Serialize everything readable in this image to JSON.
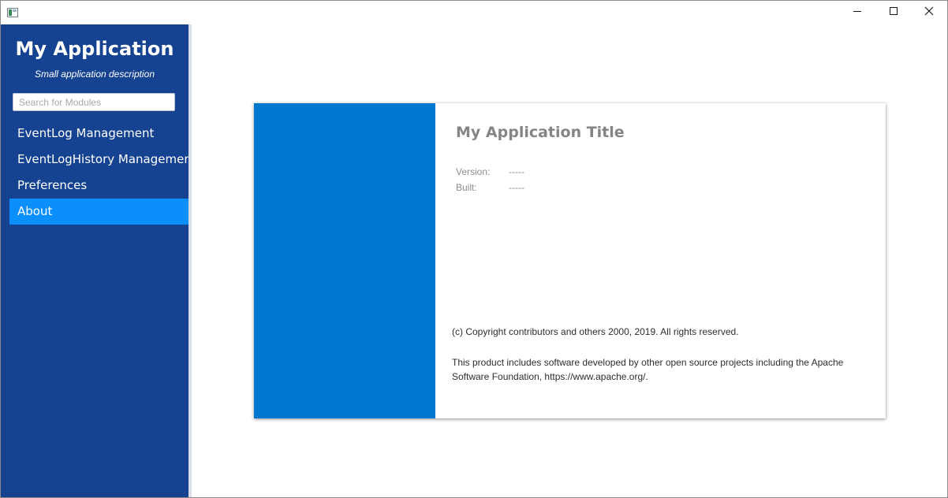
{
  "window": {
    "title": "",
    "minimize_icon": "minimize-icon",
    "maximize_icon": "maximize-icon",
    "close_icon": "close-icon"
  },
  "sidebar": {
    "title": "My Application",
    "subtitle": "Small application description",
    "search": {
      "placeholder": "Search for Modules",
      "value": ""
    },
    "items": [
      {
        "label": "EventLog Management",
        "active": false
      },
      {
        "label": "EventLogHistory Management",
        "active": false
      },
      {
        "label": "Preferences",
        "active": false
      },
      {
        "label": "About",
        "active": true
      }
    ]
  },
  "about": {
    "title": "My Application Title",
    "version_label": "Version:",
    "version_value": "-----",
    "built_label": "Built:",
    "built_value": "-----",
    "copyright": "(c) Copyright contributors and others 2000, 2019.  All rights reserved.",
    "license": "This product includes software developed by other open source projects including the Apache Software Foundation, https://www.apache.org/."
  },
  "colors": {
    "sidebar_bg": "#154391",
    "active_item_bg": "#0a8ffc",
    "card_side_bg": "#0078d0",
    "title_text": "#858585"
  }
}
